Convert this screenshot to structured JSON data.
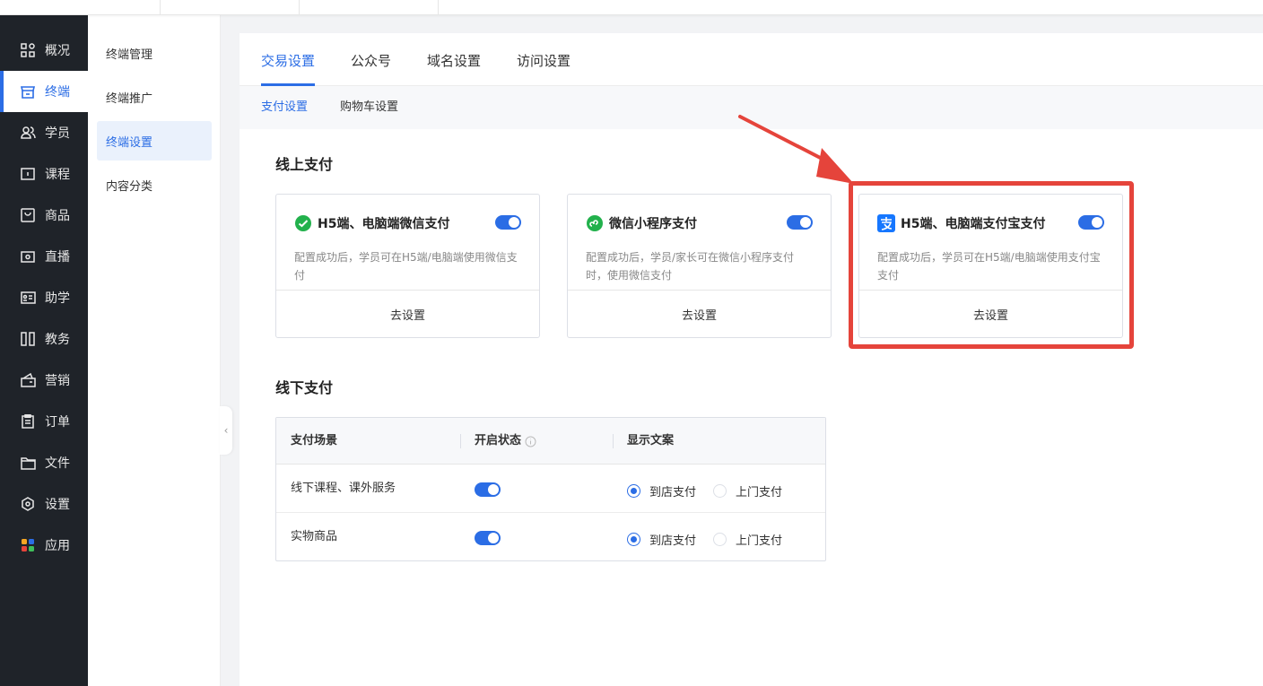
{
  "sidebar": {
    "items": [
      {
        "label": "概况",
        "icon": "grid-icon"
      },
      {
        "label": "终端",
        "icon": "store-icon"
      },
      {
        "label": "学员",
        "icon": "users-icon"
      },
      {
        "label": "课程",
        "icon": "course-icon"
      },
      {
        "label": "商品",
        "icon": "goods-icon"
      },
      {
        "label": "直播",
        "icon": "live-icon"
      },
      {
        "label": "助学",
        "icon": "study-icon"
      },
      {
        "label": "教务",
        "icon": "academic-icon"
      },
      {
        "label": "营销",
        "icon": "marketing-icon"
      },
      {
        "label": "订单",
        "icon": "order-icon"
      },
      {
        "label": "文件",
        "icon": "folder-icon"
      },
      {
        "label": "设置",
        "icon": "settings-icon"
      },
      {
        "label": "应用",
        "icon": "apps-icon"
      }
    ]
  },
  "subnav": {
    "items": [
      "终端管理",
      "终端推广",
      "终端设置",
      "内容分类"
    ]
  },
  "tabs": [
    "交易设置",
    "公众号",
    "域名设置",
    "访问设置"
  ],
  "subtabs": [
    "支付设置",
    "购物车设置"
  ],
  "online": {
    "title": "线上支付",
    "cards": [
      {
        "title": "H5端、电脑端微信支付",
        "desc": "配置成功后，学员可在H5端/电脑端使用微信支付",
        "action": "去设置"
      },
      {
        "title": "微信小程序支付",
        "desc": "配置成功后，学员/家长可在微信小程序支付时，使用微信支付",
        "action": "去设置"
      },
      {
        "title": "H5端、电脑端支付宝支付",
        "desc": "配置成功后，学员可在H5端/电脑端使用支付宝支付",
        "action": "去设置"
      }
    ]
  },
  "offline": {
    "title": "线下支付",
    "headers": [
      "支付场景",
      "开启状态",
      "显示文案"
    ],
    "rows": [
      {
        "scene": "线下课程、课外服务",
        "opt1": "到店支付",
        "opt2": "上门支付"
      },
      {
        "scene": "实物商品",
        "opt1": "到店支付",
        "opt2": "上门支付"
      }
    ]
  },
  "colors": {
    "accent": "#2b6de5",
    "highlight": "#e5443b",
    "sidebar": "#1f2329"
  }
}
